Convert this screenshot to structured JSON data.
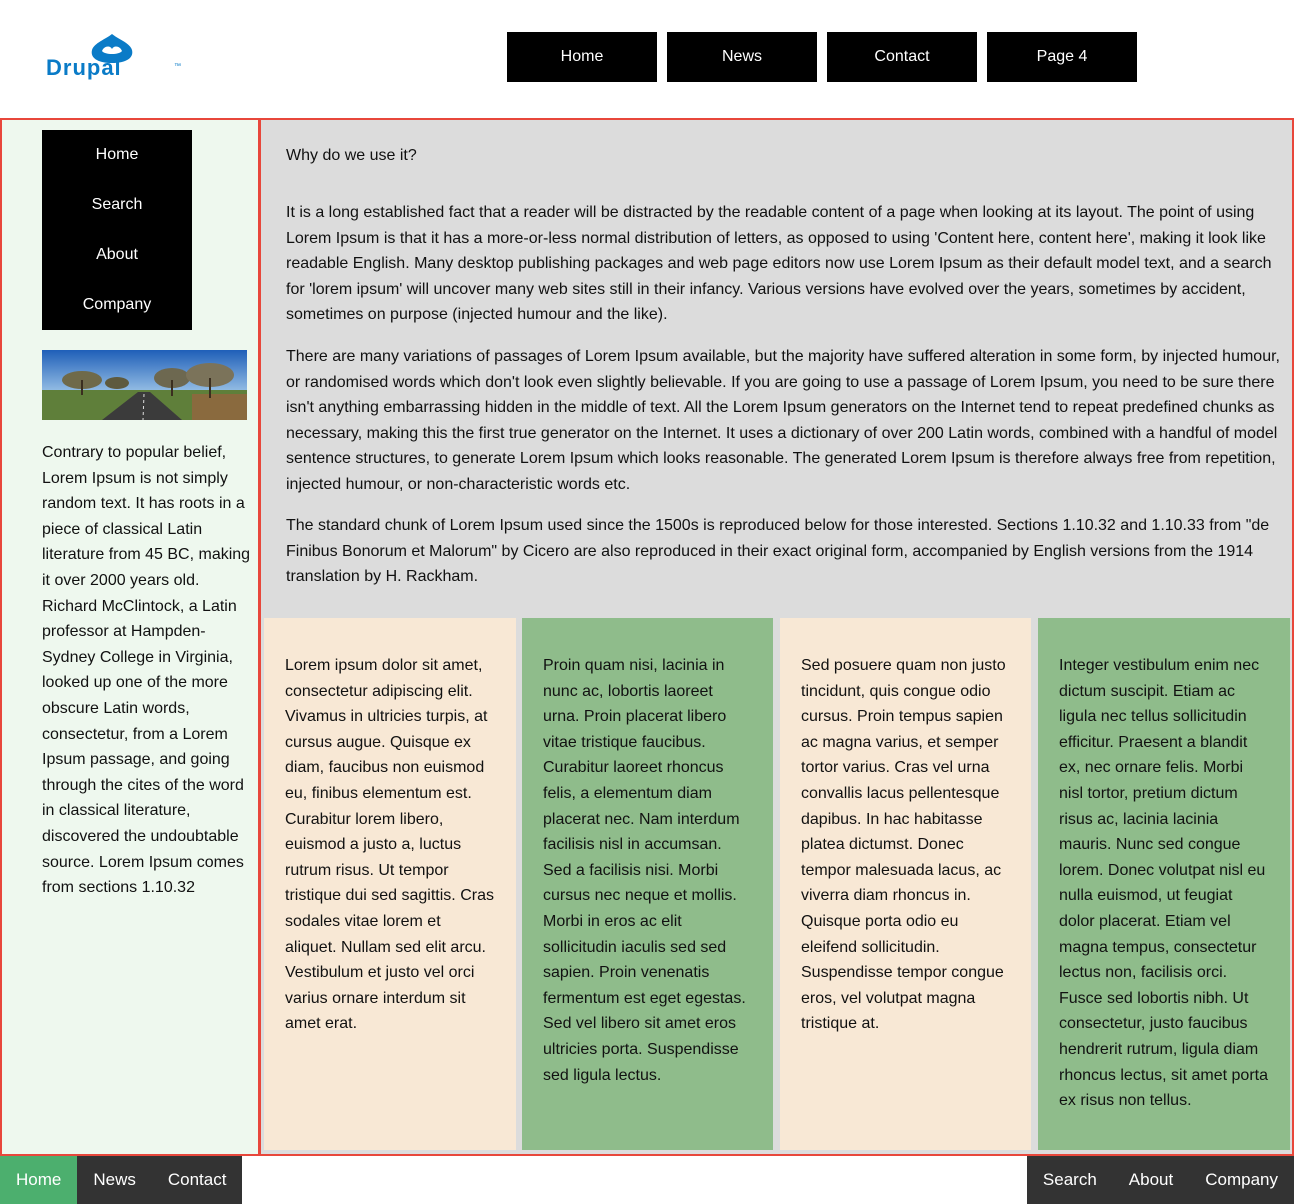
{
  "header": {
    "logo_text": "Drupal",
    "logo_tm": "™",
    "nav": [
      "Home",
      "News",
      "Contact",
      "Page 4"
    ]
  },
  "sidebar": {
    "menu": [
      "Home",
      "Search",
      "About",
      "Company"
    ],
    "image_alt": "Landscape with road and trees",
    "text": "Contrary to popular belief, Lorem Ipsum is not simply random text. It has roots in a piece of classical Latin literature from 45 BC, making it over 2000 years old. Richard McClintock, a Latin professor at Hampden-Sydney College in Virginia, looked up one of the more obscure Latin words, consectetur, from a Lorem Ipsum passage, and going through the cites of the word in classical literature, discovered the undoubtable source. Lorem Ipsum comes from sections 1.10.32"
  },
  "main": {
    "title": "Why do we use it?",
    "paragraphs": [
      "It is a long established fact that a reader will be distracted by the readable content of a page when looking at its layout. The point of using Lorem Ipsum is that it has a more-or-less normal distribution of letters, as opposed to using 'Content here, content here', making it look like readable English. Many desktop publishing packages and web page editors now use Lorem Ipsum as their default model text, and a search for 'lorem ipsum' will uncover many web sites still in their infancy. Various versions have evolved over the years, sometimes by accident, sometimes on purpose (injected humour and the like).",
      "There are many variations of passages of Lorem Ipsum available, but the majority have suffered alteration in some form, by injected humour, or randomised words which don't look even slightly believable. If you are going to use a passage of Lorem Ipsum, you need to be sure there isn't anything embarrassing hidden in the middle of text. All the Lorem Ipsum generators on the Internet tend to repeat predefined chunks as necessary, making this the first true generator on the Internet. It uses a dictionary of over 200 Latin words, combined with a handful of model sentence structures, to generate Lorem Ipsum which looks reasonable. The generated Lorem Ipsum is therefore always free from repetition, injected humour, or non-characteristic words etc.",
      "The standard chunk of Lorem Ipsum used since the 1500s is reproduced below for those interested. Sections 1.10.32 and 1.10.33 from \"de Finibus Bonorum et Malorum\" by Cicero are also reproduced in their exact original form, accompanied by English versions from the 1914 translation by H. Rackham."
    ],
    "columns": [
      "Lorem ipsum dolor sit amet, consectetur adipiscing elit. Vivamus in ultricies turpis, at cursus augue. Quisque ex diam, faucibus non euismod eu, finibus elementum est. Curabitur lorem libero, euismod a justo a, luctus rutrum risus. Ut tempor tristique dui sed sagittis. Cras sodales vitae lorem et aliquet. Nullam sed elit arcu. Vestibulum et justo vel orci varius ornare interdum sit amet erat.",
      "Proin quam nisi, lacinia in nunc ac, lobortis laoreet urna. Proin placerat libero vitae tristique faucibus. Curabitur laoreet rhoncus felis, a elementum diam placerat nec. Nam interdum facilisis nisl in accumsan. Sed a facilisis nisi. Morbi cursus nec neque et mollis. Morbi in eros ac elit sollicitudin iaculis sed sed sapien. Proin venenatis fermentum est eget egestas. Sed vel libero sit amet eros ultricies porta. Suspendisse sed ligula lectus.",
      "Sed posuere quam non justo tincidunt, quis congue odio cursus. Proin tempus sapien ac magna varius, et semper tortor varius. Cras vel urna convallis lacus pellentesque dapibus. In hac habitasse platea dictumst. Donec tempor malesuada lacus, ac viverra diam rhoncus in. Quisque porta odio eu eleifend sollicitudin. Suspendisse tempor congue eros, vel volutpat magna tristique at.",
      "Integer vestibulum enim nec dictum suscipit. Etiam ac ligula nec tellus sollicitudin efficitur. Praesent a blandit ex, nec ornare felis. Morbi nisl tortor, pretium dictum risus ac, lacinia lacinia mauris. Nunc sed congue lorem. Donec volutpat nisl eu nulla euismod, ut feugiat dolor placerat. Etiam vel magna tempus, consectetur lectus non, facilisis orci. Fusce sed lobortis nibh. Ut consectetur, justo faucibus hendrerit rutrum, ligula diam rhoncus lectus, sit amet porta ex risus non tellus."
    ]
  },
  "footer": {
    "left": [
      "Home",
      "News",
      "Contact"
    ],
    "right": [
      "Search",
      "About",
      "Company"
    ]
  },
  "colors": {
    "frame_border": "#e8473b",
    "sidebar_bg": "#eef8ee",
    "main_bg": "#dcdcdc",
    "beige": "#f8e8d5",
    "green": "#8fbc8b",
    "footer_active": "#4caf6e",
    "logo_blue": "#0a7bc7"
  }
}
